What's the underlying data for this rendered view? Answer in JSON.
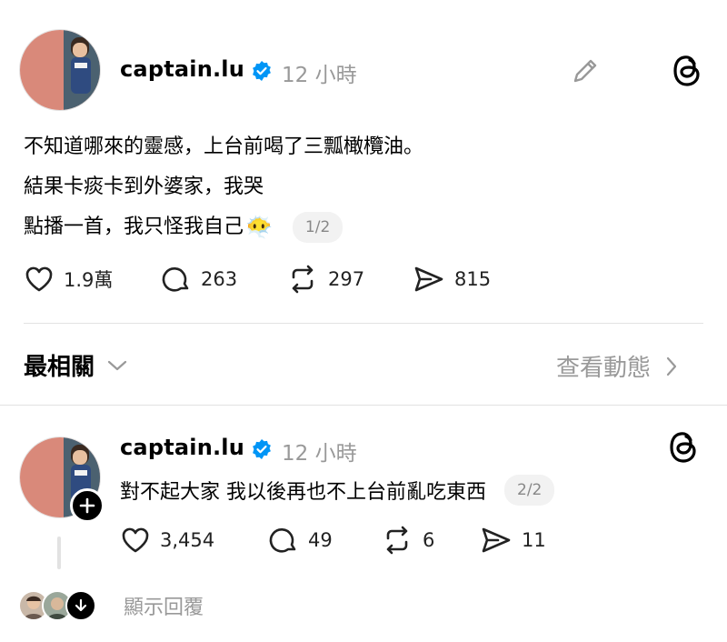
{
  "post": {
    "username": "captain.lu",
    "time": "12 小時",
    "lines": [
      "不知道哪來的靈感，上台前喝了三瓢橄欖油。",
      "結果卡痰卡到外婆家，我哭",
      "點播一首，我只怪我自己"
    ],
    "emoji": "😶‍🌫️",
    "page_indicator": "1/2",
    "likes": "1.9萬",
    "comments": "263",
    "reposts": "297",
    "shares": "815"
  },
  "sort": {
    "label": "最相關",
    "view_activity": "查看動態"
  },
  "reply": {
    "username": "captain.lu",
    "time": "12 小時",
    "text": "對不起大家 我以後再也不上台前亂吃東西",
    "page_indicator": "2/2",
    "likes": "3,454",
    "comments": "49",
    "reposts": "6",
    "shares": "11"
  },
  "show_replies": "顯示回覆"
}
